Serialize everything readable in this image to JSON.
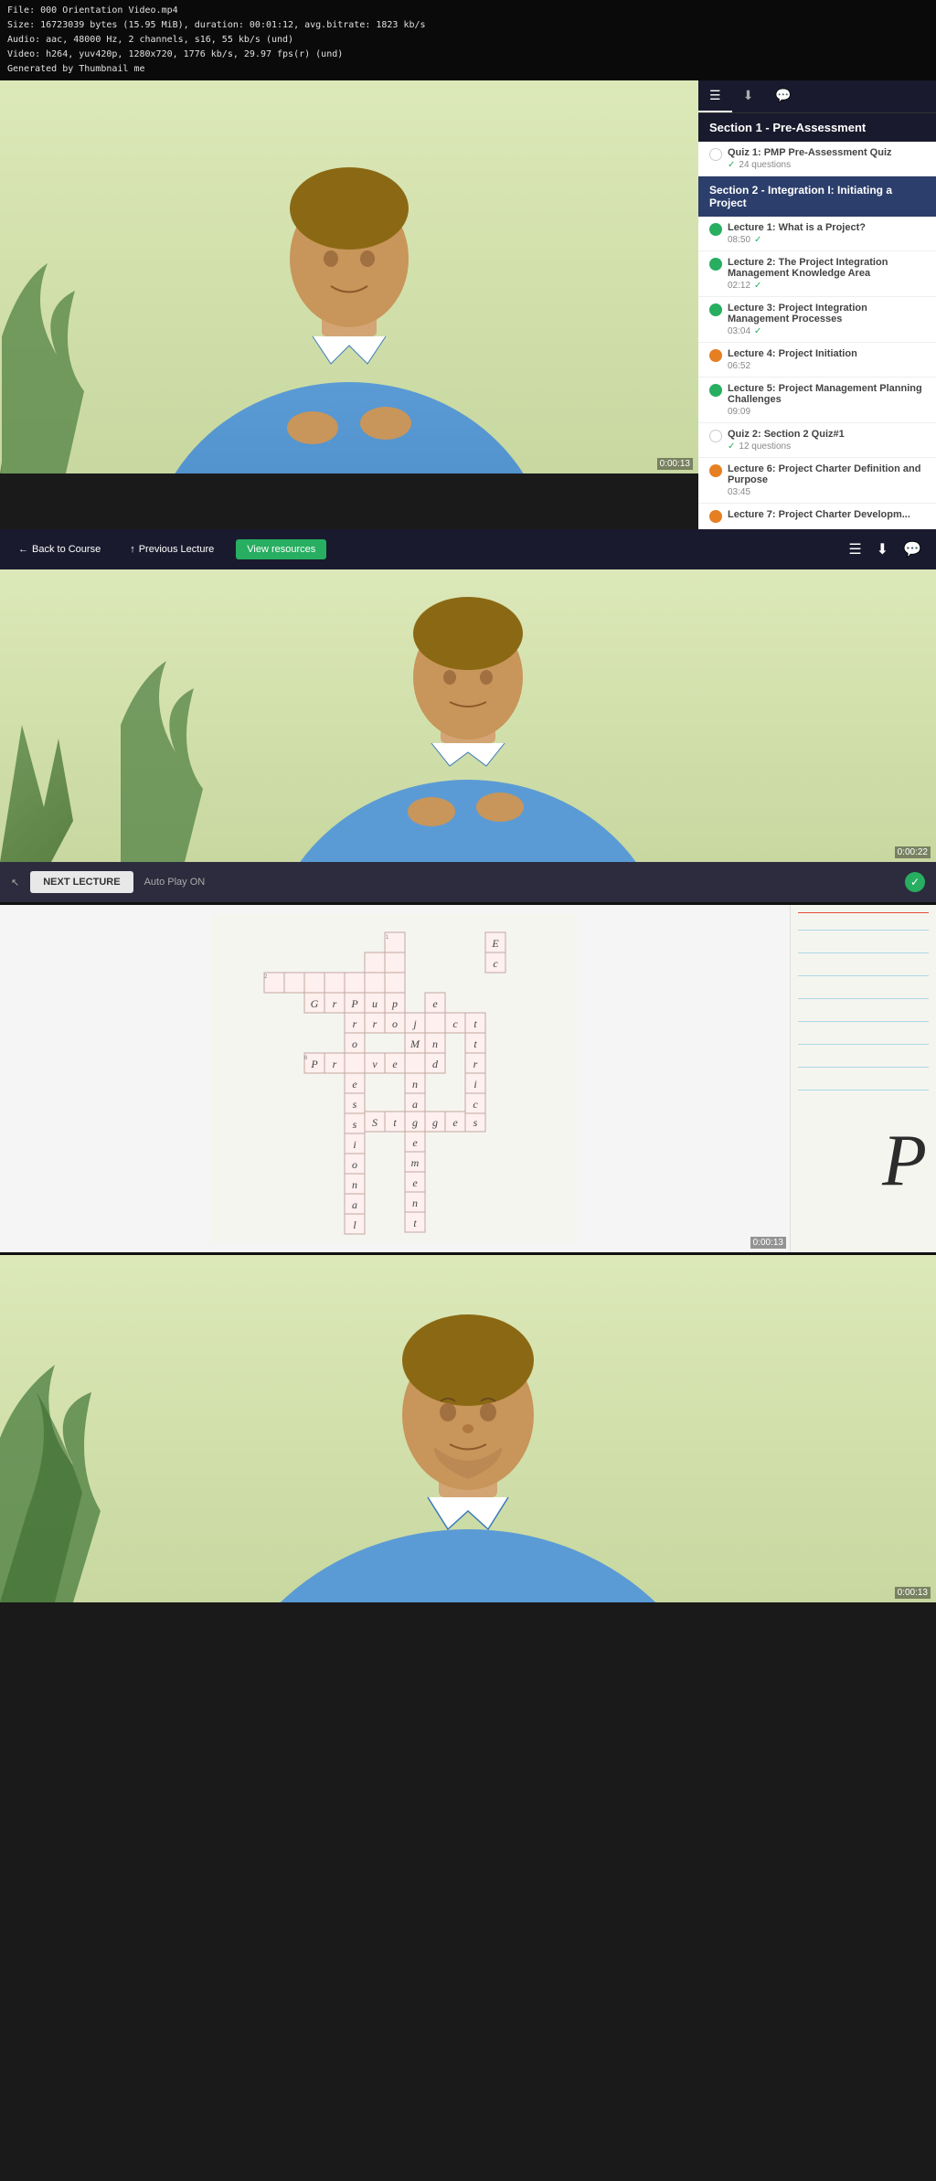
{
  "file_info": {
    "line1": "File: 000 Orientation Video.mp4",
    "line2": "Size: 16723039 bytes (15.95 MiB), duration: 00:01:12, avg.bitrate: 1823 kb/s",
    "line3": "Audio: aac, 48000 Hz, 2 channels, s16, 55 kb/s (und)",
    "line4": "Video: h264, yuv420p, 1280x720, 1776 kb/s, 29.97 fps(r) (und)",
    "line5": "Generated by Thumbnail me"
  },
  "toolbar": {
    "back_label": "Back to Course",
    "prev_label": "Previous Lecture",
    "view_resources_label": "View resources",
    "next_lecture_label": "NEXT LECTURE",
    "auto_play_label": "Auto Play ON"
  },
  "sidebar": {
    "section1_title": "Section 1 - Pre-Assessment",
    "quiz1_label": "Quiz 1: PMP Pre-Assessment Quiz",
    "quiz1_meta": "24 questions",
    "section2_title": "Section 2 - Integration I: Initiating a Project",
    "lectures": [
      {
        "id": 1,
        "title": "Lecture 1: What is a Project?",
        "meta": "08:50",
        "status": "completed"
      },
      {
        "id": 2,
        "title": "Lecture 2: The Project Integration Management Knowledge Area",
        "meta": "02:12",
        "status": "completed"
      },
      {
        "id": 3,
        "title": "Lecture 3: Project Integration Management Processes",
        "meta": "03:04",
        "status": "completed"
      },
      {
        "id": 4,
        "title": "Lecture 4: Project Initiation",
        "meta": "06:52",
        "status": "current"
      },
      {
        "id": 5,
        "title": "Lecture 5: Project Management Planning Challenges",
        "meta": "09:09",
        "status": "completed"
      },
      {
        "id": "q2",
        "title": "Quiz 2: Section 2 Quiz#1",
        "meta": "12 questions",
        "status": "quiz"
      },
      {
        "id": 6,
        "title": "Lecture 6: Project Charter Definition and Purpose",
        "meta": "03:45",
        "status": "current"
      },
      {
        "id": 7,
        "title": "Lecture 7: Project Charter Developm...",
        "meta": "",
        "status": "current"
      }
    ]
  },
  "timestamps": {
    "top": "0:00:13",
    "middle": "0:00:22",
    "bottom": "0:00:13",
    "crossword": "0:00:13"
  },
  "crossword": {
    "title": "Crossword puzzle frame",
    "letter_P": "P"
  },
  "colors": {
    "sidebar_header": "#1a1a2e",
    "section_title": "#2c3e6b",
    "accent_green": "#27ae60",
    "accent_orange": "#e67e22",
    "background_video": "#dce8b8"
  }
}
